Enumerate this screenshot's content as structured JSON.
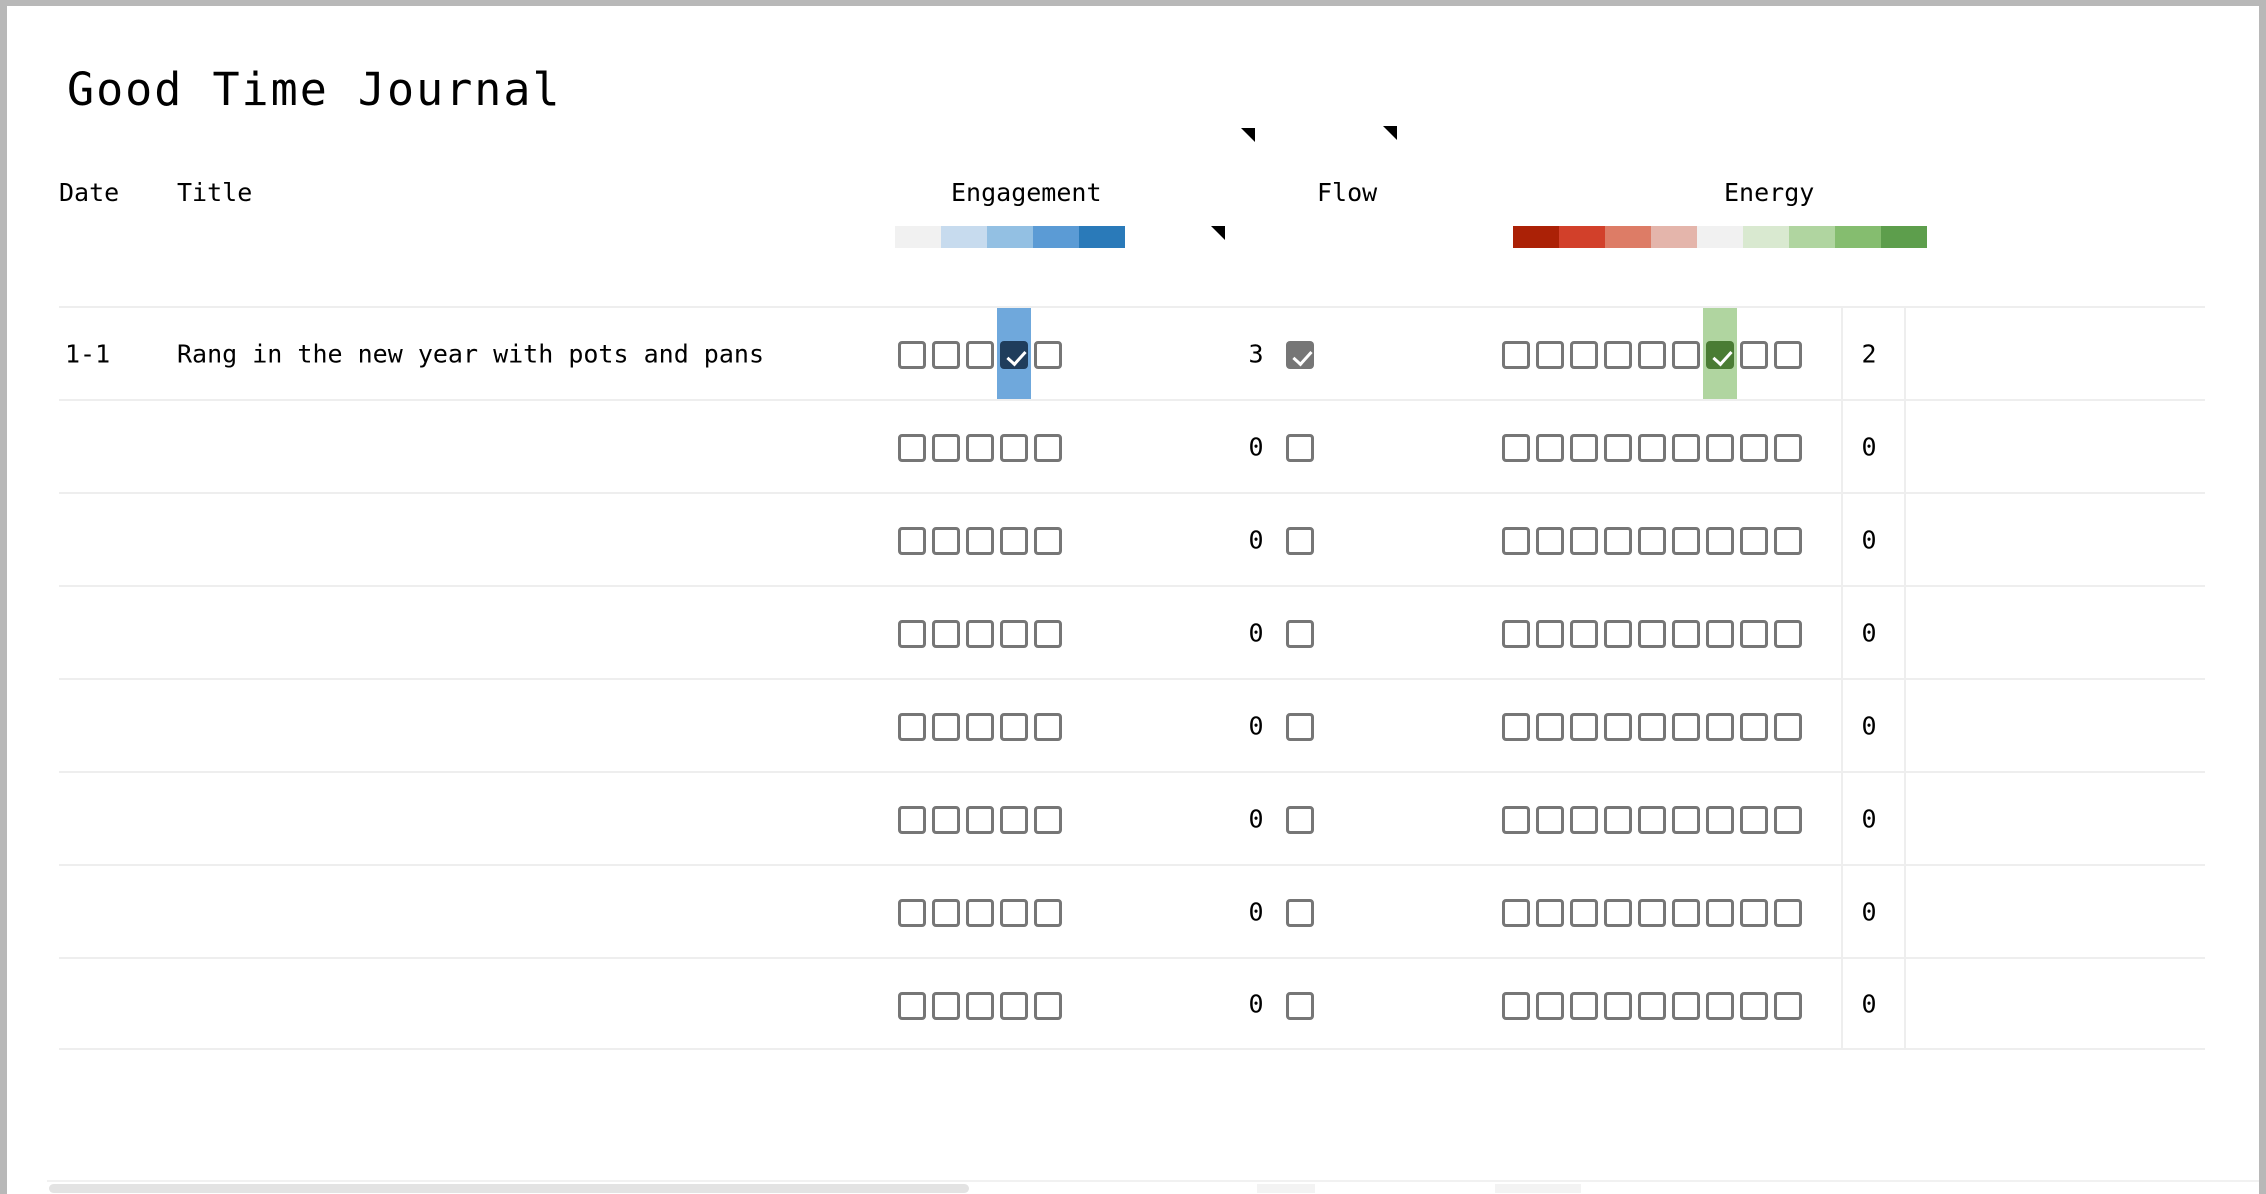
{
  "app": {
    "title": "Good Time Journal"
  },
  "table": {
    "headers": {
      "date": "Date",
      "title": "Title",
      "engagement": "Engagement",
      "flow": "Flow",
      "energy": "Energy"
    },
    "legend": {
      "engagement": {
        "name": "engagement-color-scale",
        "colors": [
          "#f1f1f1",
          "#c7dbee",
          "#93c0e3",
          "#5b9bd5",
          "#2a7ab9"
        ]
      },
      "energy": {
        "name": "energy-color-scale",
        "colors": [
          "#ab2106",
          "#d2402a",
          "#dd7c66",
          "#e4b5ab",
          "#f1f1f1",
          "#d9e9d0",
          "#b0d5a0",
          "#85bd6f",
          "#5d9e4c"
        ]
      }
    },
    "column_counts": {
      "engagement_checkboxes": 5,
      "flow_checkboxes": 1,
      "energy_checkboxes": 9
    },
    "rows": [
      {
        "date": "1-1",
        "title": "Rang in the new year with pots and pans",
        "engagement_checked_index": 3,
        "engagement_value": "3",
        "flow_checked": true,
        "energy_checked_index": 6,
        "energy_value": "2"
      },
      {
        "date": "",
        "title": "",
        "engagement_checked_index": -1,
        "engagement_value": "0",
        "flow_checked": false,
        "energy_checked_index": -1,
        "energy_value": "0"
      },
      {
        "date": "",
        "title": "",
        "engagement_checked_index": -1,
        "engagement_value": "0",
        "flow_checked": false,
        "energy_checked_index": -1,
        "energy_value": "0"
      },
      {
        "date": "",
        "title": "",
        "engagement_checked_index": -1,
        "engagement_value": "0",
        "flow_checked": false,
        "energy_checked_index": -1,
        "energy_value": "0"
      },
      {
        "date": "",
        "title": "",
        "engagement_checked_index": -1,
        "engagement_value": "0",
        "flow_checked": false,
        "energy_checked_index": -1,
        "energy_value": "0"
      },
      {
        "date": "",
        "title": "",
        "engagement_checked_index": -1,
        "engagement_value": "0",
        "flow_checked": false,
        "energy_checked_index": -1,
        "energy_value": "0"
      },
      {
        "date": "",
        "title": "",
        "engagement_checked_index": -1,
        "engagement_value": "0",
        "flow_checked": false,
        "energy_checked_index": -1,
        "energy_value": "0"
      },
      {
        "date": "",
        "title": "",
        "engagement_checked_index": -1,
        "engagement_value": "0",
        "flow_checked": false,
        "energy_checked_index": -1,
        "energy_value": "0"
      }
    ]
  },
  "markers": [
    {
      "name": "engagement-header-comment-marker"
    },
    {
      "name": "engagement-ramp-left-comment-marker"
    },
    {
      "name": "engagement-ramp-right-comment-marker"
    },
    {
      "name": "flow-header-comment-marker"
    }
  ],
  "scrollbar": {
    "name": "horizontal-scrollbar",
    "orientation": "horizontal"
  },
  "colors": {
    "highlight_blue": "#6fa8dc",
    "highlight_green": "#b0d5a0",
    "checkbox_border": "#767676",
    "checkbox_checked_gray": "#767676",
    "checkbox_checked_blue": "#1f3d5c",
    "checkbox_checked_green": "#4a7c34",
    "row_divider": "#eeeeee",
    "page_background": "#ffffff",
    "canvas_background": "#b8b8b8"
  }
}
